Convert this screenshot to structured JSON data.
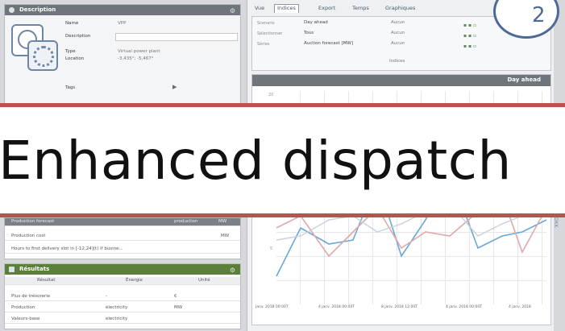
{
  "slide_number": "2",
  "banner_title": "Enhanced dispatch",
  "description_panel": {
    "title": "Description",
    "fields": [
      {
        "label": "Name",
        "value": "VPP"
      },
      {
        "label": "Description",
        "value": ""
      },
      {
        "label": "Type",
        "value": "Virtual power plant"
      },
      {
        "label": "Location",
        "value": "-3,435°; -5,467°"
      },
      {
        "label": "Tags",
        "value": ""
      }
    ]
  },
  "inputs_table": {
    "rows": [
      {
        "name": "Production forecast",
        "type": "production",
        "unit": "MW"
      },
      {
        "name": "Production cost",
        "type": "",
        "unit": "MW"
      },
      {
        "name": "Hours to first delivery slot in [-12,24](t) if busine...",
        "type": "",
        "unit": ""
      }
    ]
  },
  "results_panel": {
    "title": "Résultats",
    "columns": [
      "Résultat",
      "Énergie",
      "Unité"
    ],
    "rows": [
      {
        "result": "Plus de trésorerie",
        "energy": "-",
        "unit": "€"
      },
      {
        "result": "Production",
        "energy": "electricity",
        "unit": "MW"
      },
      {
        "result": "Valeurs-base",
        "energy": "electricity",
        "unit": ""
      }
    ]
  },
  "tabs": [
    "Vue",
    "Indices",
    "Export",
    "Temps",
    "Graphiques"
  ],
  "active_tab": "Indices",
  "indices": {
    "rows": [
      {
        "label": "Scenario",
        "value": "Day ahead",
        "auto": "Aucun"
      },
      {
        "label": "Sélectionner",
        "value": "Tous",
        "auto": "Aucun"
      },
      {
        "label": "Séries",
        "value": "Auction forecast [MW]",
        "auto": "Aucun"
      }
    ],
    "footer": "Indices"
  },
  "chart": {
    "title": "Day ahead",
    "y_tick_top": "20",
    "y_tick_mid": "5",
    "x_ticks": [
      "janv. 2018 00:00T",
      "4 janv. 2018 00:00T",
      "8 janv. 2018 12:00T",
      "4 janv. 2018 00:00T",
      "4 janv. 2018"
    ],
    "side_label": "DKK"
  },
  "colors": {
    "header": "#6f757b",
    "results_header": "#5c7f3c",
    "banner_border": "#b85450",
    "slide_badge": "#4b6a96"
  }
}
